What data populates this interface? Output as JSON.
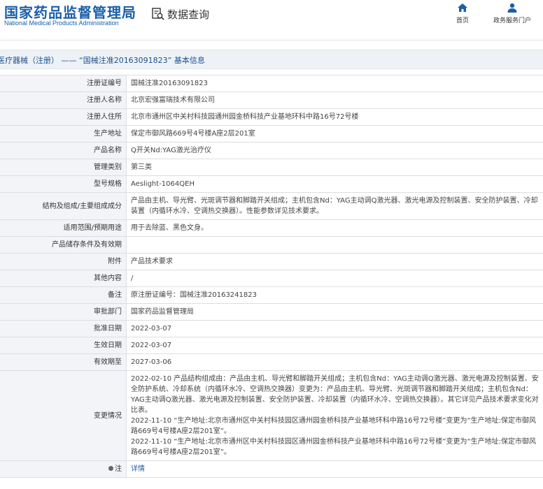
{
  "header": {
    "logo_cn": "国家药品监督管理局",
    "logo_en": "National Medical Products Administration",
    "query_label": "数据查询",
    "nav": [
      {
        "label": "首页",
        "icon": "home-icon"
      },
      {
        "label": "政务服务门户",
        "icon": "user-icon"
      }
    ]
  },
  "breadcrumb": "医疗器械（注册） —— “国械注准20163091823” 基本信息",
  "rows": [
    {
      "label": "注册证编号",
      "value": "国械注准20163091823"
    },
    {
      "label": "注册人名称",
      "value": "北京宏强富瑞技术有限公司"
    },
    {
      "label": "注册人住所",
      "value": "北京市通州区中关村科技园通州园金桥科技产业基地环科中路16号72号楼"
    },
    {
      "label": "生产地址",
      "value": "保定市御风路669号4号楼A座2层201室"
    },
    {
      "label": "产品名称",
      "value": "Q开关Nd:YAG激光治疗仪"
    },
    {
      "label": "管理类别",
      "value": "第三类"
    },
    {
      "label": "型号规格",
      "value": "Aeslight-1064QEH"
    },
    {
      "label": "结构及组成/主要组成成分",
      "value": "产品由主机、导光臂、光斑调节器和脚踏开关组成；主机包含Nd：YAG主动调Q激光器、激光电源及控制装置、安全防护装置、冷却装置（内循环水冷、空调热交换器）。性能参数详见技术要求。"
    },
    {
      "label": "适用范围/预期用途",
      "value": "用于去除蓝、黑色文身。"
    },
    {
      "label": "产品储存条件及有效期",
      "value": ""
    },
    {
      "label": "附件",
      "value": "产品技术要求"
    },
    {
      "label": "其他内容",
      "value": "/"
    },
    {
      "label": "备注",
      "value": "原注册证编号：国械注准20163241823"
    },
    {
      "label": "审批部门",
      "value": "国家药品监督管理局"
    },
    {
      "label": "批准日期",
      "value": "2022-03-07"
    },
    {
      "label": "生效日期",
      "value": "2022-03-07"
    },
    {
      "label": "有效期至",
      "value": "2027-03-06"
    }
  ],
  "changes": {
    "label": "变更情况",
    "entries": [
      "2022-02-10 产品结构组成由：产品由主机、导光臂和脚踏开关组成；主机包含Nd：YAG主动调Q激光器、激光电源及控制装置、安全防护系统、冷却系统（内循环水冷、空调热交换器）变更为：产品由主机、导光臂、光斑调节器和脚踏开关组成；主机包含Nd：YAG主动调Q激光器、激光电源及控制装置、安全防护装置、冷却装置（内循环水冷、空调热交换器）。其它详见产品技术要求变化对比表。",
      "2022-11-10 “生产地址:北京市通州区中关村科技园区通州园金桥科技产业基地环科中路16号72号楼”变更为“生产地址:保定市御风路669号4号楼A座2层201室”。",
      "2022-11-10 “生产地址:北京市通州区中关村科技园区通州园金桥科技产业基地环科中路16号72号楼”变更为“生产地址:保定市御风路669号4号楼A座2层201室”。"
    ]
  },
  "note": {
    "label": "注",
    "link": "详情"
  }
}
